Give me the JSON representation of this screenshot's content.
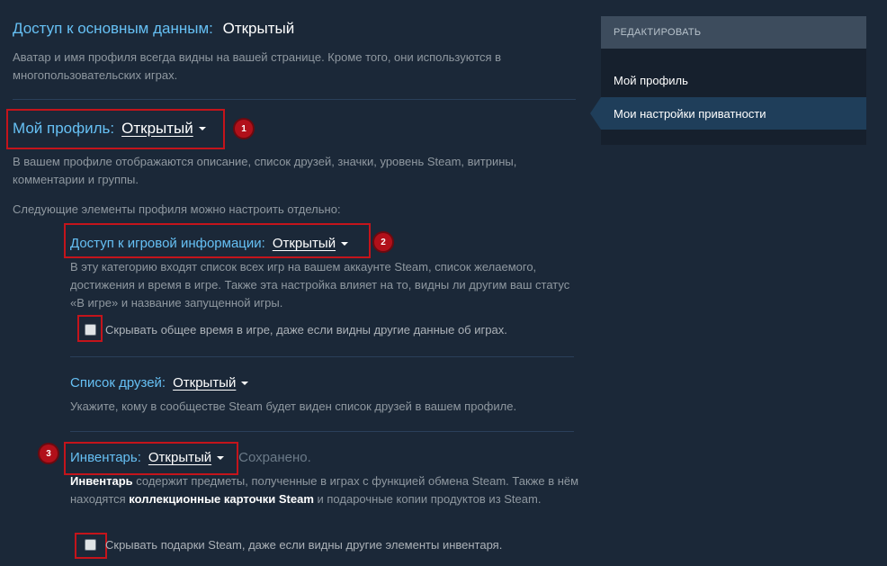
{
  "basic": {
    "label": "Доступ к основным данным:",
    "value": "Открытый",
    "desc": "Аватар и имя профиля всегда видны на вашей странице. Кроме того, они используются в многопользовательских играх."
  },
  "profile": {
    "label": "Мой профиль:",
    "value": "Открытый",
    "badge": "1",
    "desc": "В вашем профиле отображаются описание, список друзей, значки, уровень Steam, витрины, комментарии и группы.",
    "sub_intro": "Следующие элементы профиля можно настроить отдельно:"
  },
  "game": {
    "label": "Доступ к игровой информации:",
    "value": "Открытый",
    "badge": "2",
    "desc": "В эту категорию входят список всех игр на вашем аккаунте Steam, список желаемого, достижения и время в игре. Также эта настройка влияет на то, видны ли другим ваш статус «В игре» и название запущенной игры.",
    "checkbox": "Скрывать общее время в игре, даже если видны другие данные об играх."
  },
  "friends": {
    "label": "Список друзей:",
    "value": "Открытый",
    "desc": "Укажите, кому в сообществе Steam будет виден список друзей в вашем профиле."
  },
  "inventory": {
    "label": "Инвентарь:",
    "value": "Открытый",
    "saved": "Сохранено.",
    "badge": "3",
    "desc_bold1": "Инвентарь",
    "desc_part1": " содержит предметы, полученные в играх с функцией обмена Steam. Также в нём находятся ",
    "desc_bold2": "коллекционные карточки Steam",
    "desc_part2": " и подарочные копии продуктов из Steam.",
    "checkbox": "Скрывать подарки Steam, даже если видны другие элементы инвентаря."
  },
  "panel": {
    "header": "РЕДАКТИРОВАТЬ",
    "items": [
      {
        "label": "Мой профиль"
      },
      {
        "label": "Мои настройки приватности"
      }
    ]
  }
}
